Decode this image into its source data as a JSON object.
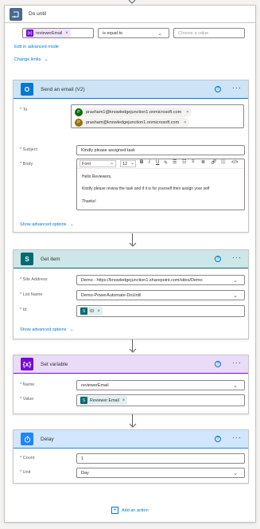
{
  "do_until": {
    "title": "Do until",
    "condition": {
      "left_token": "reviewerEmail",
      "operator": "is equal to",
      "value_placeholder": "Choose a value"
    },
    "edit_advanced": "Edit in advanced mode",
    "change_limits": "Change limits"
  },
  "send_email": {
    "title": "Send an email (V2)",
    "to_label": "* To",
    "recipients": [
      {
        "initial": "P",
        "email": "prasham1@knowledgejunction1.onmicrosoft.com",
        "color": "#0b6a0b"
      },
      {
        "initial": "P",
        "email": "prasham@knowledgejunction1.onmicrosoft.com",
        "color": "#986f0b"
      }
    ],
    "subject_label": "* Subject",
    "subject_value": "Kindly please assigned task",
    "body_label": "* Body",
    "toolbar": {
      "font": "Font",
      "size": "12"
    },
    "body_lines": [
      "Hello Reviewers,",
      "Kindly please review the task and if it is for yourself then assign your self",
      "Thanks!"
    ],
    "show_advanced": "Show advanced options"
  },
  "get_item": {
    "title": "Get item",
    "site_label": "* Site Address",
    "site_value": "Demo - https://knowledgejunction1.sharepoint.com/sites/Demo",
    "list_label": "* List Name",
    "list_value": "Demo-PowerAutomate-DoUntil",
    "id_label": "* Id",
    "id_token": "ID",
    "show_advanced": "Show advanced options"
  },
  "set_variable": {
    "title": "Set variable",
    "name_label": "* Name",
    "name_value": "reviewerEmail",
    "value_label": "* Value",
    "value_token": "Reviewer Email"
  },
  "delay": {
    "title": "Delay",
    "count_label": "* Count",
    "count_value": "1",
    "unit_label": "* Unit",
    "unit_value": "Day"
  },
  "add_action": "Add an action",
  "colors": {
    "do_until": "#486991",
    "outlook": "#0078d4",
    "sharepoint": "#036c70",
    "variable": "#770bd6",
    "delay": "#1f85ff",
    "accent": "#0078d4"
  },
  "icons": {
    "do_until": "loop-icon",
    "outlook": "outlook-icon",
    "sharepoint": "sharepoint-icon",
    "variable": "variable-icon",
    "delay": "timer-icon"
  }
}
